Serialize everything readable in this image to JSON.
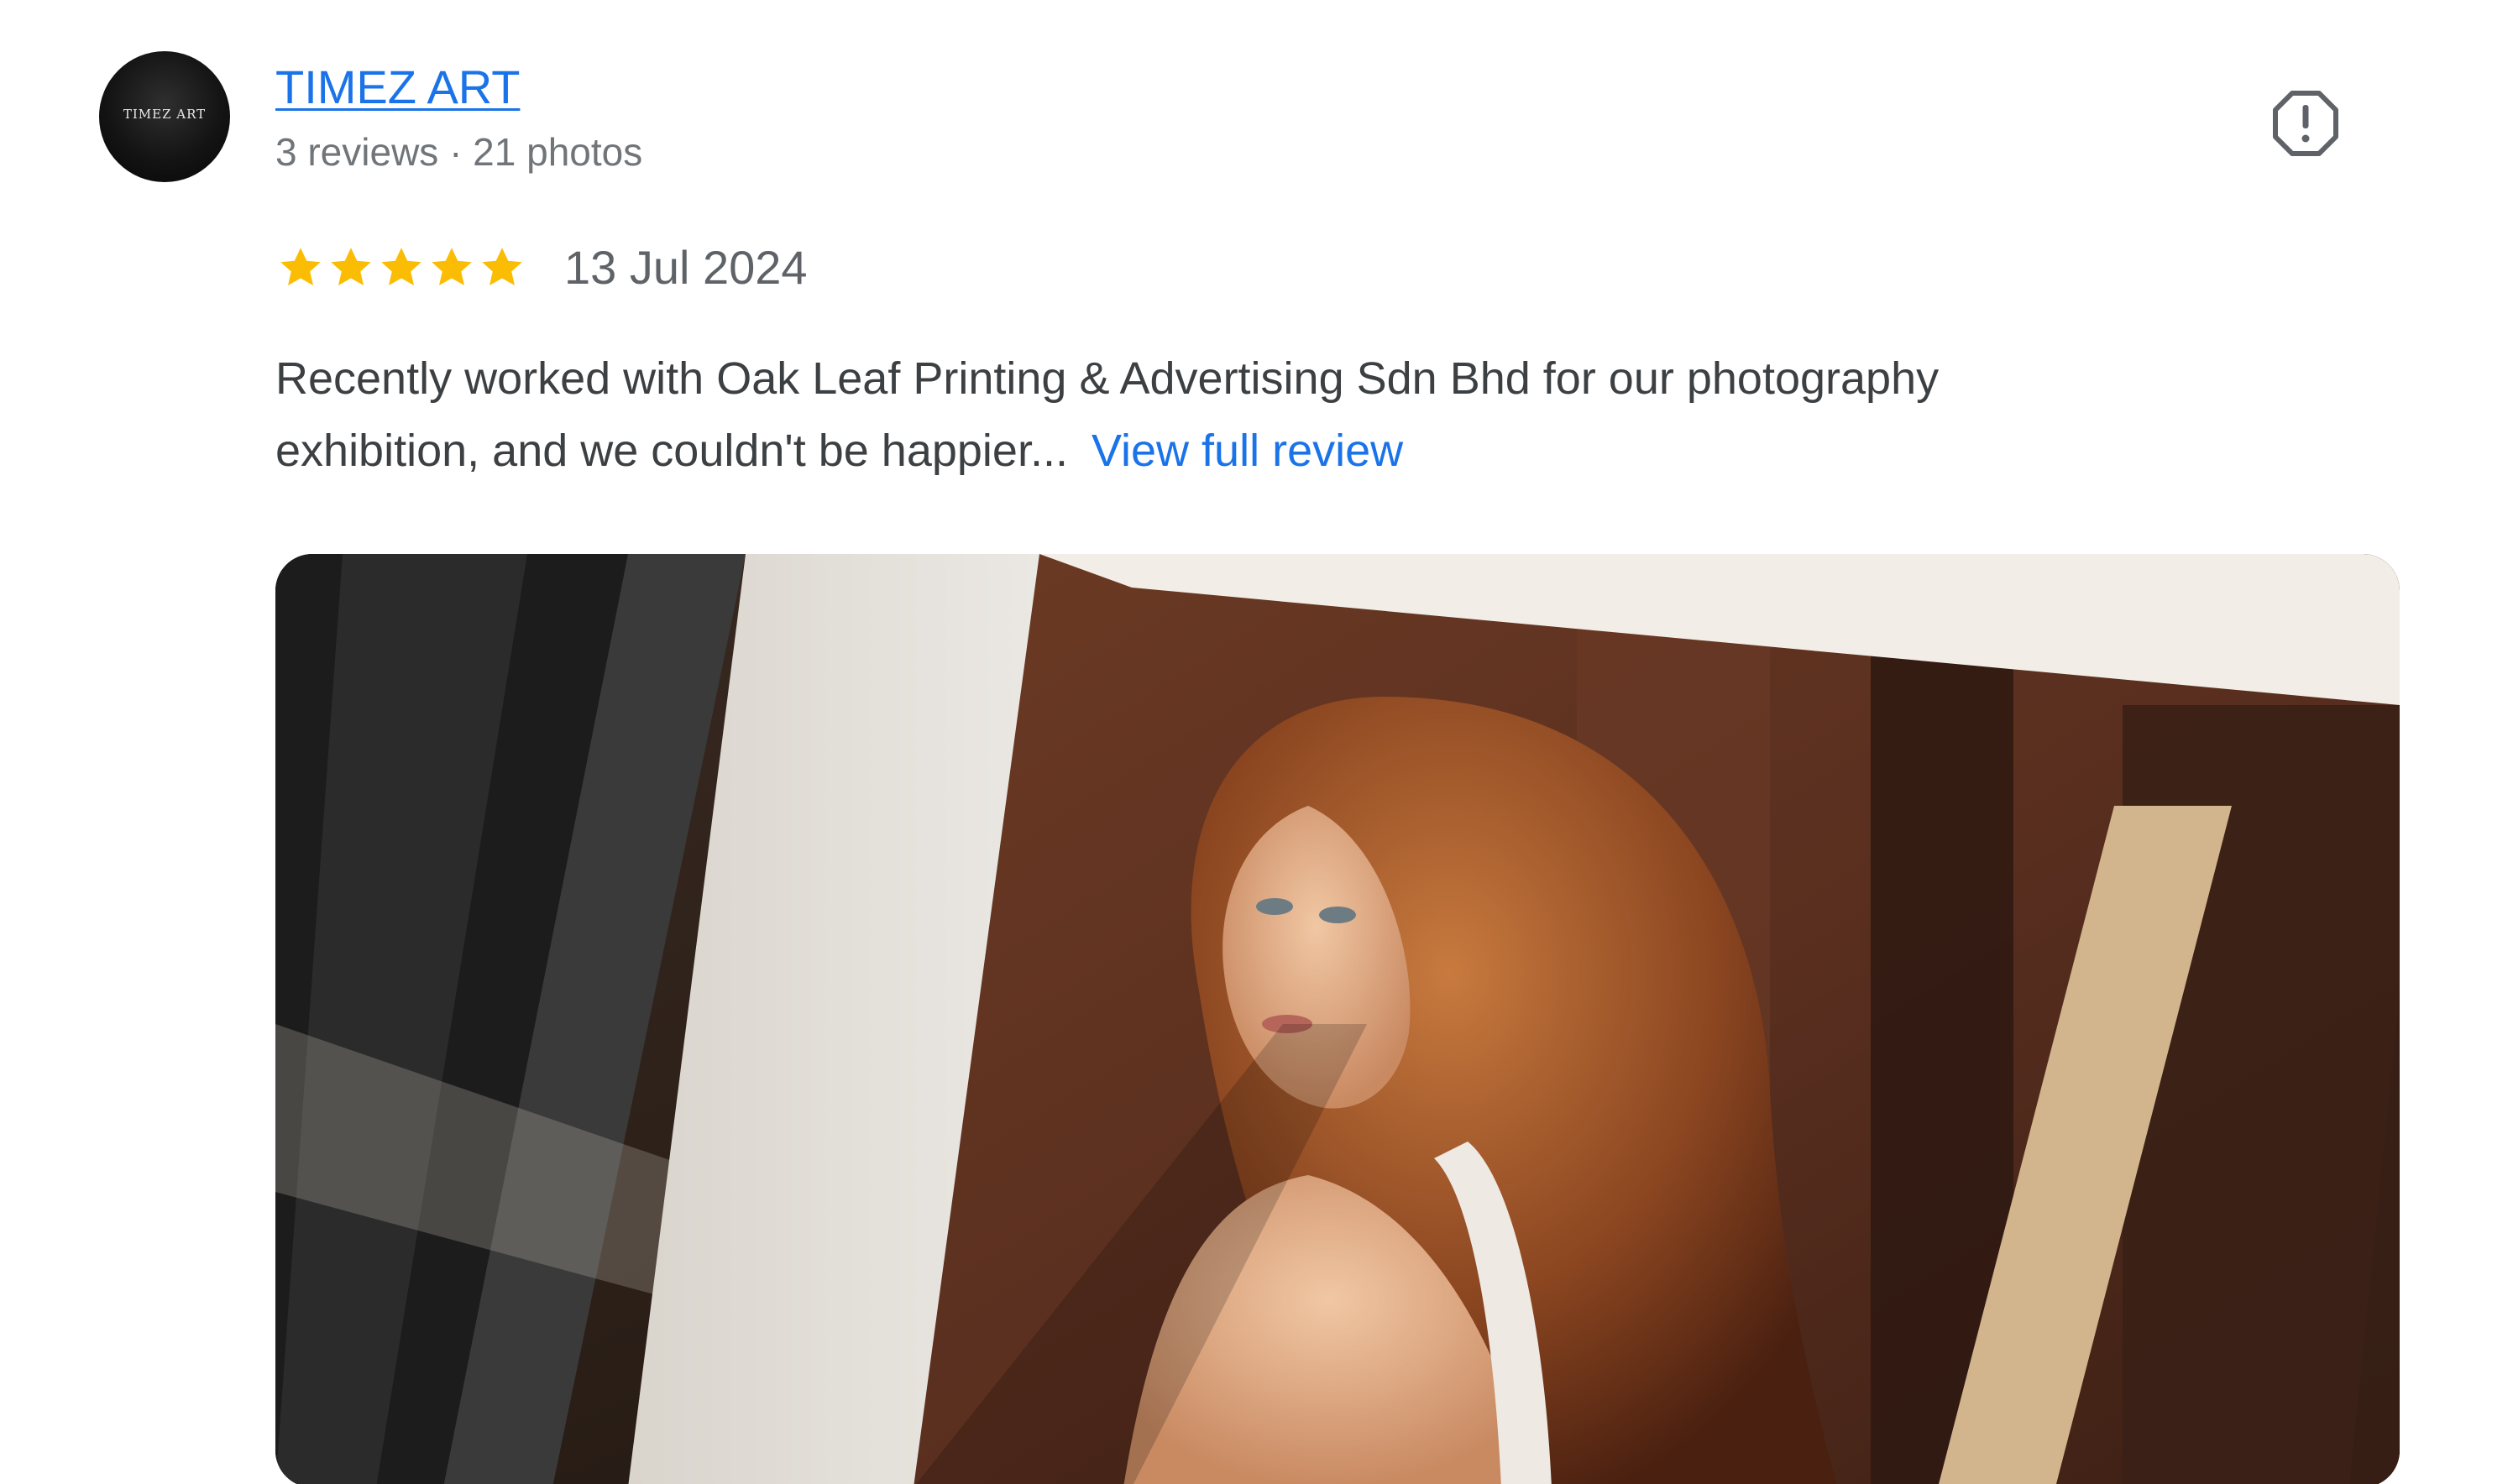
{
  "reviewer": {
    "avatar_text": "TIMEZ ART",
    "name": "TIMEZ ART",
    "meta": "3 reviews · 21 photos"
  },
  "review": {
    "rating": 5,
    "rating_max": 5,
    "date": "13 Jul 2024",
    "text_line1": "Recently worked with Oak Leaf Printing & Advertising Sdn Bhd for our photography",
    "text_line2": "exhibition, and we couldn't be happier...",
    "view_full_label": "View full review"
  },
  "icons": {
    "report": "flag-report-icon",
    "star": "star-icon"
  },
  "colors": {
    "link": "#1a73e8",
    "star": "#fbbc04",
    "meta_text": "#70757a",
    "body_text": "#3c4043"
  }
}
